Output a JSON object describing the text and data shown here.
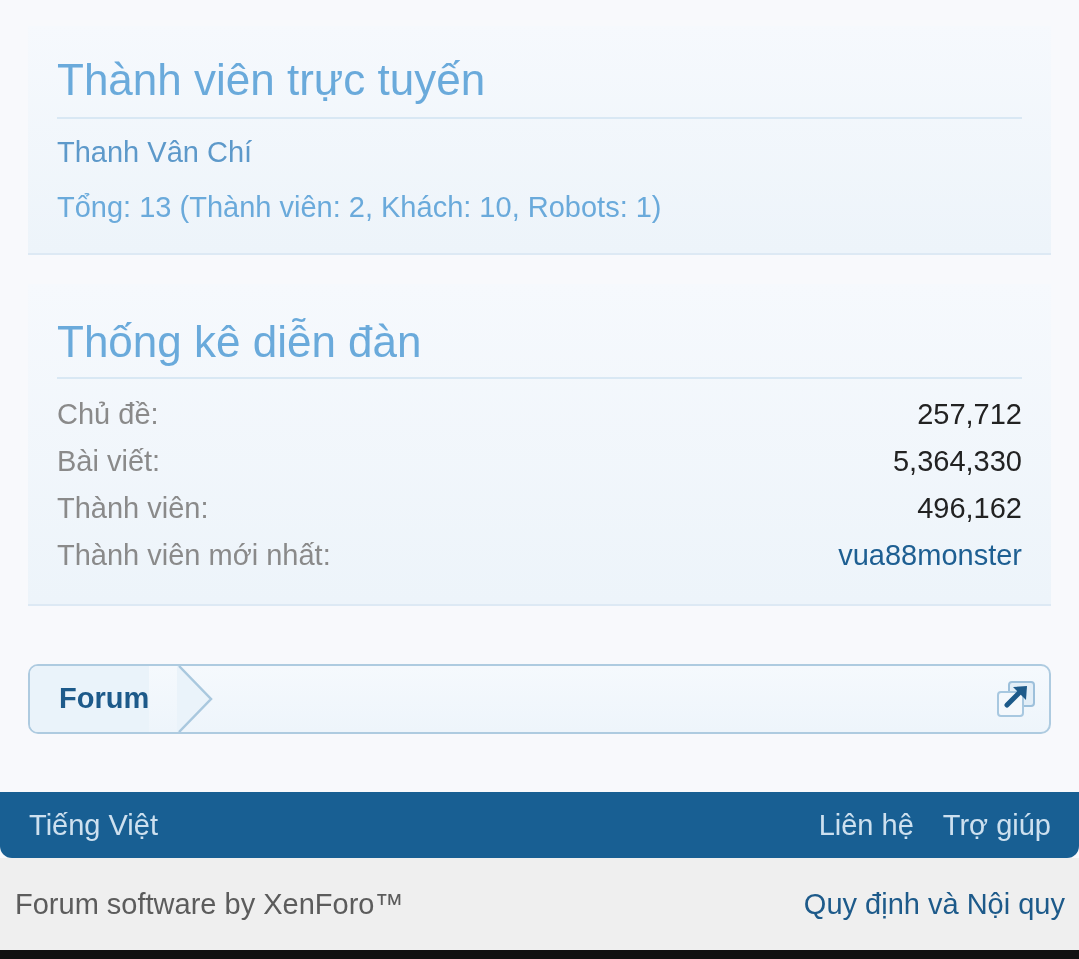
{
  "online_members": {
    "title": "Thành viên trực tuyến",
    "members": [
      "Thanh Vân Chí"
    ],
    "summary": "Tổng: 13 (Thành viên: 2, Khách: 10, Robots: 1)"
  },
  "forum_statistics": {
    "title": "Thống kê diễn đàn",
    "rows": [
      {
        "label": "Chủ đề:",
        "value": "257,712",
        "kind": "number"
      },
      {
        "label": "Bài viết:",
        "value": "5,364,330",
        "kind": "number"
      },
      {
        "label": "Thành viên:",
        "value": "496,162",
        "kind": "number"
      },
      {
        "label": "Thành viên mới nhất:",
        "value": "vua88monster",
        "kind": "link"
      }
    ]
  },
  "breadcrumb": {
    "items": [
      "Forum"
    ]
  },
  "footer": {
    "language": "Tiếng Việt",
    "links": [
      "Liên hệ",
      "Trợ giúp"
    ]
  },
  "copyright": {
    "text": "Forum software by XenForo™",
    "link": "Quy định và Nội quy"
  }
}
